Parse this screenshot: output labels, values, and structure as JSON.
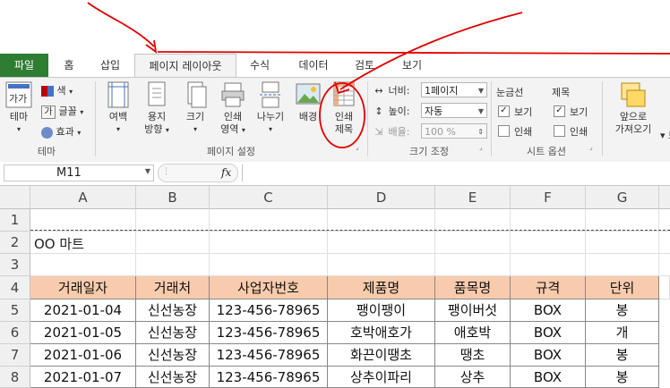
{
  "tabs": [
    "파일",
    "홈",
    "삽입",
    "페이지 레이아웃",
    "수식",
    "데이터",
    "검토",
    "보기"
  ],
  "ribbon": {
    "theme_group": {
      "label": "테마",
      "theme_btn": "테마",
      "colors": "색",
      "fonts": "글꼴",
      "effects": "효과",
      "aa_icon": "가가"
    },
    "page_setup": {
      "label": "페이지 설정",
      "margins": "여백",
      "orientation": [
        "용지",
        "방향"
      ],
      "size": "크기",
      "print_area": [
        "인쇄",
        "영역"
      ],
      "breaks": "나누기",
      "background": "배경",
      "print_titles": [
        "인쇄",
        "제목"
      ]
    },
    "scale": {
      "label": "크기 조정",
      "width_label": "너비:",
      "width_value": "1페이지",
      "height_label": "높이:",
      "height_value": "자동",
      "scale_label": "배율:",
      "scale_value": "100 %"
    },
    "sheet_options": {
      "label": "시트 옵션",
      "gridlines": "눈금선",
      "headings": "제목",
      "view": "보기",
      "print": "인쇄",
      "gridlines_view": true,
      "gridlines_print": false,
      "headings_view": true,
      "headings_print": false
    },
    "arrange": {
      "bring_forward": [
        "앞으로",
        "가져오기"
      ],
      "cut": "▾ 보"
    }
  },
  "formula_bar": {
    "name_box": "M11",
    "fx": "fx",
    "formula": ""
  },
  "columns": [
    "A",
    "B",
    "C",
    "D",
    "E",
    "F",
    "G"
  ],
  "rows": [
    "1",
    "2",
    "3",
    "4",
    "5",
    "6",
    "7",
    "8"
  ],
  "sheet": {
    "title": "OO 마트",
    "headers": [
      "거래일자",
      "거래처",
      "사업자번호",
      "제품명",
      "품목명",
      "규격",
      "단위"
    ],
    "data": [
      [
        "2021-01-04",
        "신선농장",
        "123-456-78965",
        "팽이팽이",
        "팽이버섯",
        "BOX",
        "봉"
      ],
      [
        "2021-01-05",
        "신선농장",
        "123-456-78965",
        "호박애호가",
        "애호박",
        "BOX",
        "개"
      ],
      [
        "2021-01-06",
        "신선농장",
        "123-456-78965",
        "화끈이땡초",
        "땡초",
        "BOX",
        "봉"
      ],
      [
        "2021-01-07",
        "신선농장",
        "123-456-78965",
        "상추이파리",
        "상추",
        "BOX",
        "봉"
      ]
    ]
  },
  "colors": {
    "file_tab": "#2e7d32",
    "header_fill": "#f8cbad",
    "annotation": "#e00000"
  }
}
